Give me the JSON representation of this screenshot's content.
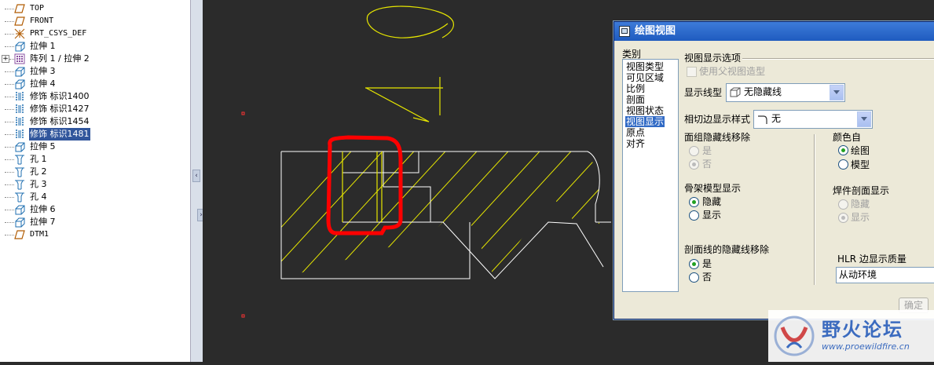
{
  "model_tree": {
    "items": [
      {
        "label": "TOP",
        "icon": "datum-plane-icon"
      },
      {
        "label": "FRONT",
        "icon": "datum-plane-icon"
      },
      {
        "label": "PRT_CSYS_DEF",
        "icon": "csys-icon"
      },
      {
        "label": "拉伸 1",
        "icon": "extrude-icon"
      },
      {
        "label": "阵列 1 / 拉伸 2",
        "icon": "pattern-icon"
      },
      {
        "label": "拉伸 3",
        "icon": "extrude-icon"
      },
      {
        "label": "拉伸 4",
        "icon": "extrude-icon"
      },
      {
        "label": "修饰 标识1400",
        "icon": "cosmetic-thread-icon"
      },
      {
        "label": "修饰 标识1427",
        "icon": "cosmetic-thread-icon"
      },
      {
        "label": "修饰 标识1454",
        "icon": "cosmetic-thread-icon"
      },
      {
        "label": "修饰 标识1481",
        "icon": "cosmetic-thread-icon"
      },
      {
        "label": "拉伸 5",
        "icon": "extrude-icon"
      },
      {
        "label": "孔 1",
        "icon": "hole-icon"
      },
      {
        "label": "孔 2",
        "icon": "hole-icon"
      },
      {
        "label": "孔 3",
        "icon": "hole-icon"
      },
      {
        "label": "孔 4",
        "icon": "hole-icon"
      },
      {
        "label": "拉伸 6",
        "icon": "extrude-icon"
      },
      {
        "label": "拉伸 7",
        "icon": "extrude-icon"
      },
      {
        "label": "DTM1",
        "icon": "datum-plane-icon"
      }
    ],
    "selected": "修饰 标识1481",
    "expander": "+"
  },
  "splitter": {
    "collapse_glyph": "‹",
    "expand_glyph": "›"
  },
  "dialog": {
    "title": "绘图视图",
    "category_header": "类别",
    "categories": [
      "视图类型",
      "可见区域",
      "比例",
      "剖面",
      "视图状态",
      "视图显示",
      "原点",
      "对齐"
    ],
    "selected_category": "视图显示",
    "section_title": "视图显示选项",
    "use_parent_style": {
      "label": "使用父视图造型",
      "checked": false,
      "enabled": false
    },
    "display_style": {
      "label": "显示线型",
      "value": "无隐藏线"
    },
    "tangent_edge": {
      "label": "相切边显示样式",
      "value": "无"
    },
    "face_group_hlr": {
      "label": "面组隐藏线移除",
      "options": [
        "是",
        "否"
      ],
      "selected": "否",
      "enabled": false
    },
    "color_from": {
      "label": "颜色自",
      "options": [
        "绘图",
        "模型"
      ],
      "selected": "绘图"
    },
    "skeleton_display": {
      "label": "骨架模型显示",
      "options": [
        "隐藏",
        "显示"
      ],
      "selected": "隐藏"
    },
    "weld_xsec_display": {
      "label": "焊件剖面显示",
      "options": [
        "隐藏",
        "显示"
      ],
      "selected": "显示",
      "enabled": false
    },
    "xsec_hlr": {
      "label": "剖面线的隐藏线移除",
      "options": [
        "是",
        "否"
      ],
      "selected": "是"
    },
    "hlr_quality": {
      "label": "HLR 边显示质量",
      "value": "从动环境"
    },
    "ok_label": "确定"
  },
  "watermark": {
    "text": "野火论坛",
    "url": "www.proewildfire.cn"
  },
  "colors": {
    "accent_selection": "#316ac5",
    "drawing_lines": "#e6e600",
    "drawing_highlight": "#ff0000",
    "canvas_bg": "#2b2b2b"
  }
}
